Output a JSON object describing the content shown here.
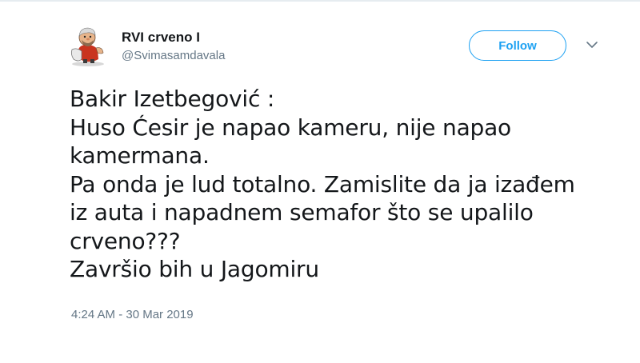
{
  "author": {
    "display_name": "RVI crveno I",
    "handle": "@Svimasamdavala",
    "avatar_icon": "cartoon-character-avatar"
  },
  "actions": {
    "follow_label": "Follow",
    "menu_icon": "chevron-down-icon"
  },
  "tweet": {
    "lines": [
      "Bakir Izetbegović :",
      "Huso Ćesir je napao kameru, nije napao",
      "kamermana.",
      "Pa onda je lud totalno. Zamislite da ja izađem",
      "iz auta i napadnem semafor što se upalilo",
      "crveno???",
      "Završio bih u Jagomiru"
    ],
    "timestamp": "4:24 AM - 30 Mar 2019"
  },
  "colors": {
    "accent": "#1da1f2",
    "text": "#14171a",
    "secondary_text": "#657786"
  }
}
